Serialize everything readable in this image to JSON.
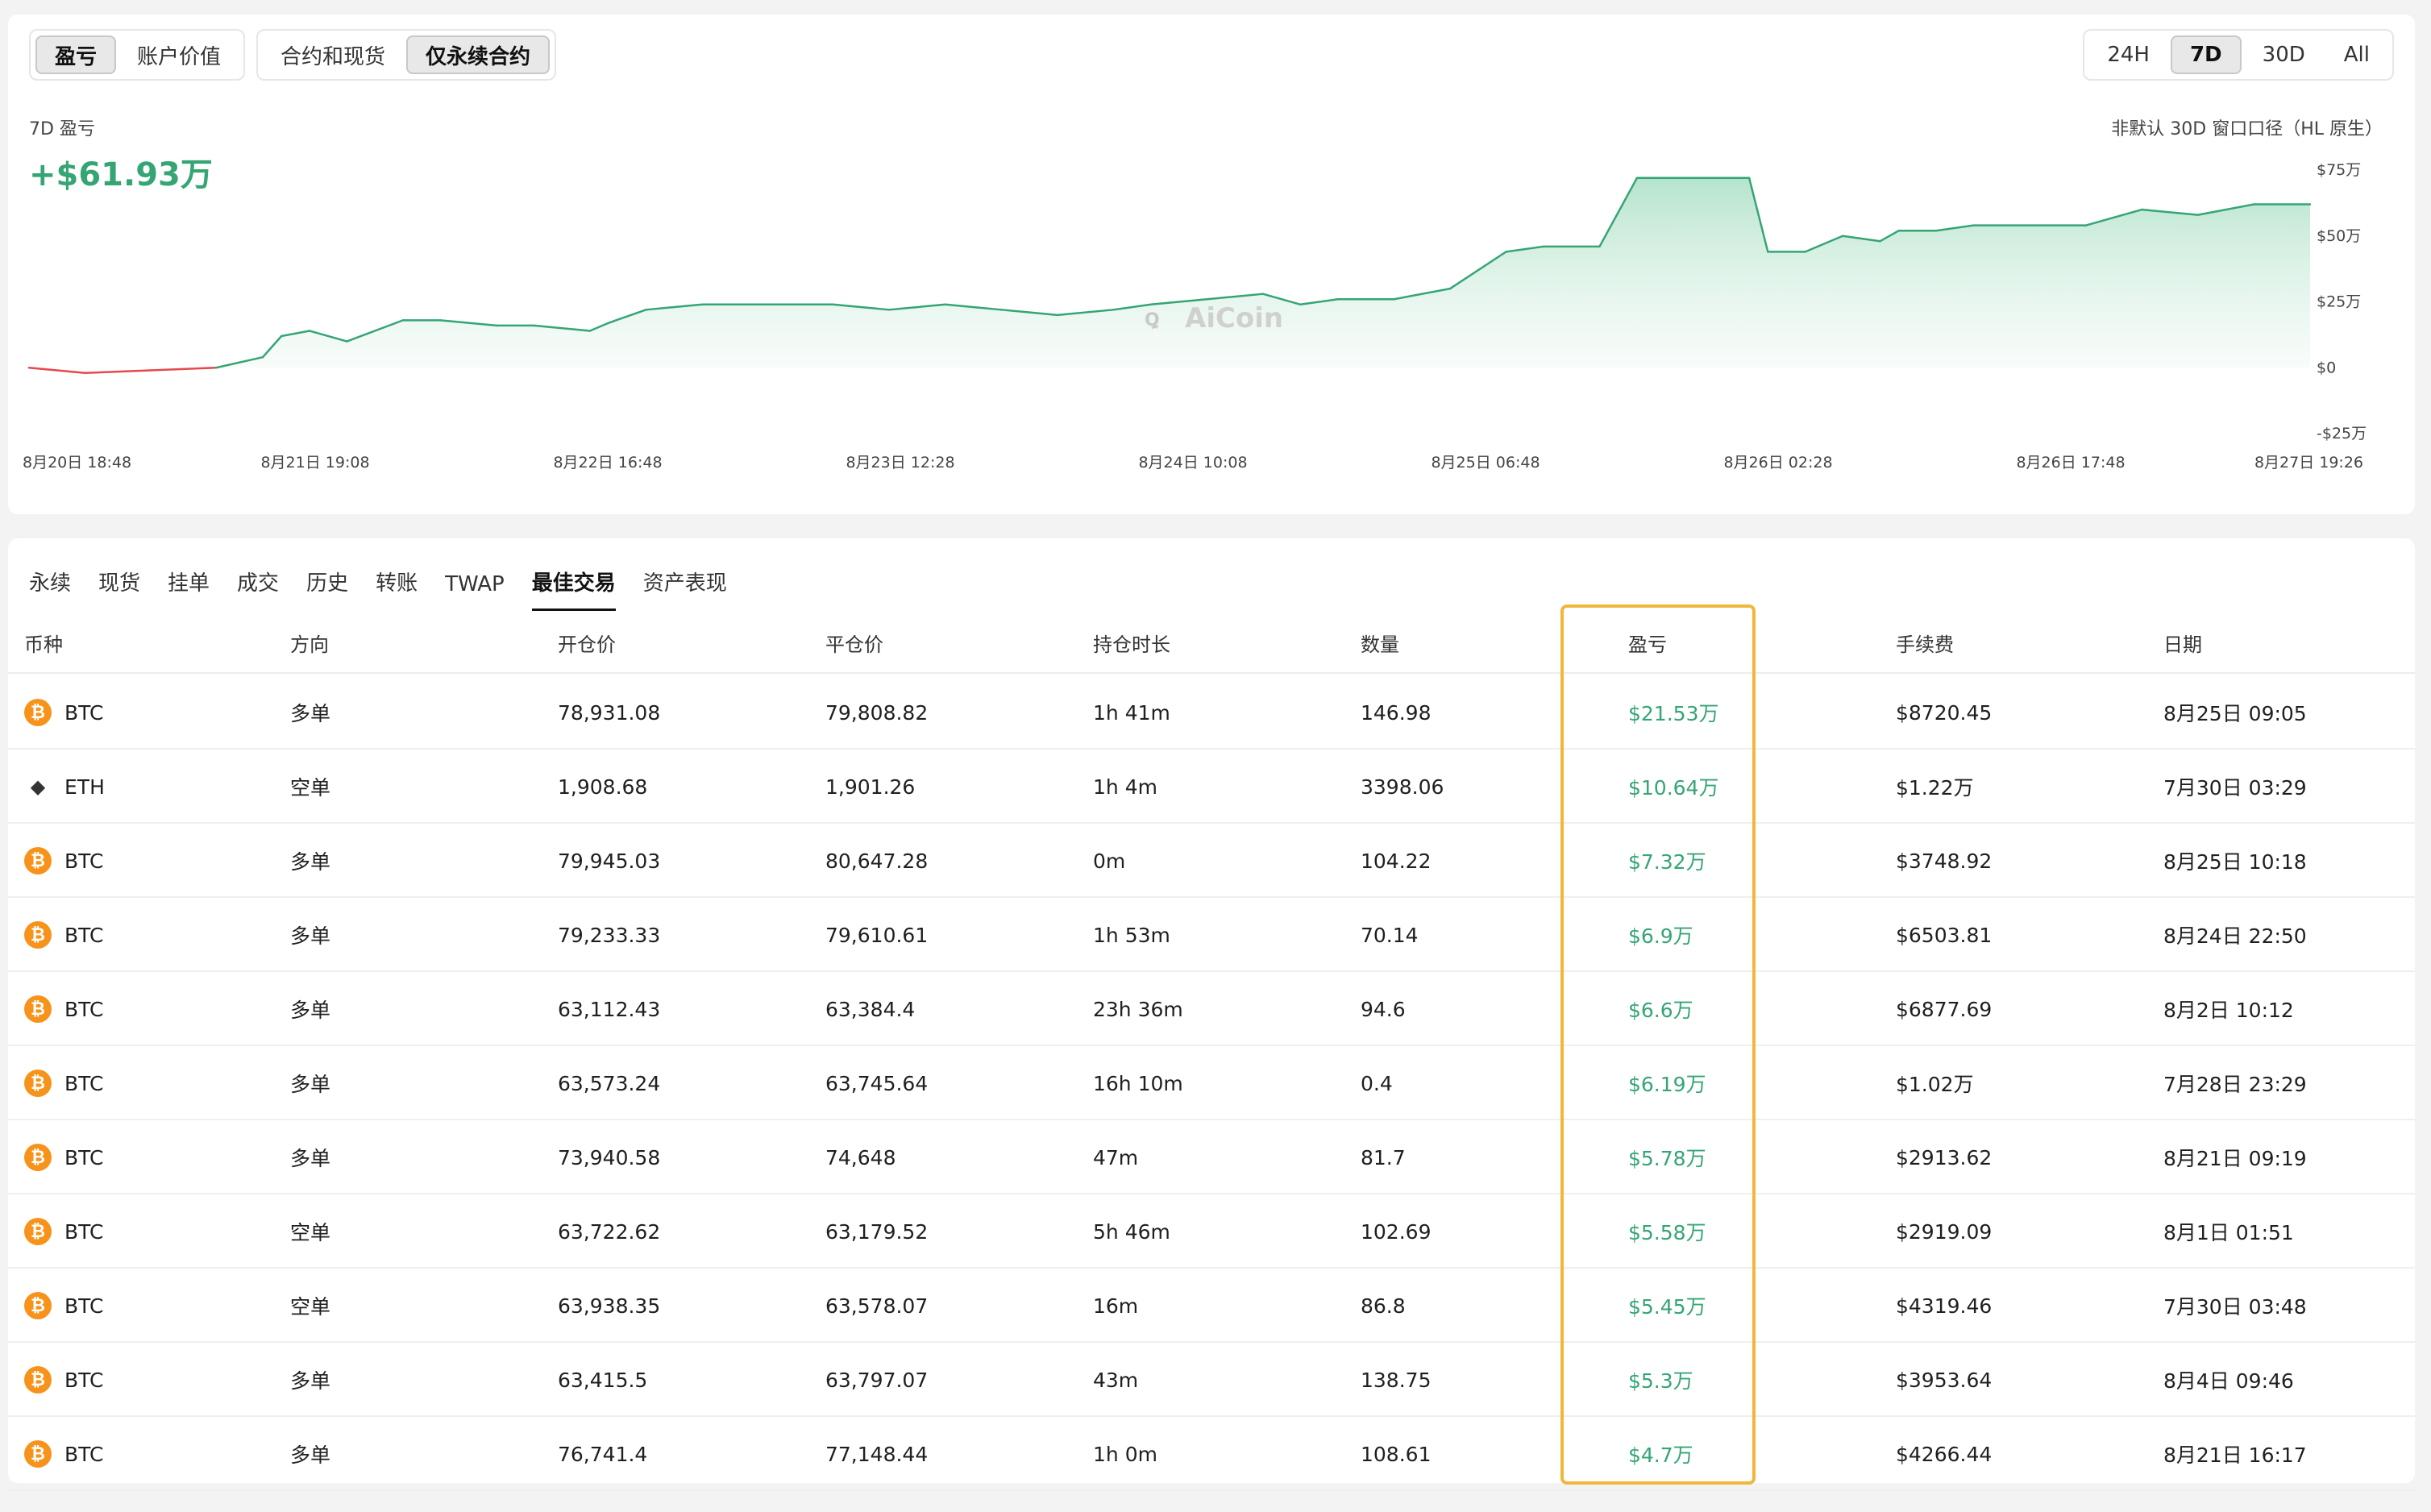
{
  "controls": {
    "metric_tabs": [
      {
        "label": "盈亏",
        "active": true
      },
      {
        "label": "账户价值",
        "active": false
      }
    ],
    "scope_tabs": [
      {
        "label": "合约和现货",
        "active": false
      },
      {
        "label": "仅永续合约",
        "active": true
      }
    ],
    "range_tabs": [
      {
        "label": "24H",
        "active": false
      },
      {
        "label": "7D",
        "active": true
      },
      {
        "label": "30D",
        "active": false
      },
      {
        "label": "All",
        "active": false
      }
    ]
  },
  "chart": {
    "label": "7D 盈亏",
    "value": "+$61.93万",
    "note": "非默认 30D 窗口口径（HL 原生）",
    "watermark": "AiCoin",
    "colors": {
      "positive": "#35a574",
      "negative": "#e5484d",
      "fill": "#cdeedd"
    }
  },
  "chart_data": {
    "type": "area",
    "y_unit": "万",
    "ylim": [
      -25,
      75
    ],
    "yticks": [
      {
        "value": 75,
        "label": "$75万"
      },
      {
        "value": 50,
        "label": "$50万"
      },
      {
        "value": 25,
        "label": "$25万"
      },
      {
        "value": 0,
        "label": "$0"
      },
      {
        "value": -25,
        "label": "-$25万"
      }
    ],
    "xticks": [
      "8月20日 18:48",
      "8月21日 19:08",
      "8月22日 16:48",
      "8月23日 12:28",
      "8月24日 10:08",
      "8月25日 06:48",
      "8月26日 02:28",
      "8月26日 17:48",
      "8月27日 19:26"
    ],
    "x": [
      0,
      0.03,
      0.065,
      0.1,
      0.125,
      0.135,
      0.15,
      0.17,
      0.2,
      0.22,
      0.25,
      0.27,
      0.3,
      0.31,
      0.33,
      0.36,
      0.4,
      0.43,
      0.46,
      0.49,
      0.52,
      0.55,
      0.58,
      0.6,
      0.63,
      0.66,
      0.68,
      0.7,
      0.73,
      0.76,
      0.79,
      0.81,
      0.84,
      0.86,
      0.88,
      0.9,
      0.92,
      0.93,
      0.95,
      0.97,
      0.99,
      1.0,
      1.02,
      1.04,
      1.07,
      1.1,
      1.13,
      1.16,
      1.19,
      1.22
    ],
    "y": [
      0,
      -2,
      -1,
      0,
      4,
      12,
      14,
      10,
      18,
      18,
      16,
      16,
      14,
      17,
      22,
      24,
      24,
      24,
      22,
      24,
      22,
      20,
      22,
      24,
      26,
      28,
      24,
      26,
      26,
      30,
      44,
      46,
      46,
      72,
      72,
      72,
      72,
      44,
      44,
      50,
      48,
      52,
      52,
      54,
      54,
      54,
      60,
      58,
      62,
      62
    ]
  },
  "table": {
    "tabs": [
      {
        "label": "永续",
        "active": false
      },
      {
        "label": "现货",
        "active": false
      },
      {
        "label": "挂单",
        "active": false
      },
      {
        "label": "成交",
        "active": false
      },
      {
        "label": "历史",
        "active": false
      },
      {
        "label": "转账",
        "active": false
      },
      {
        "label": "TWAP",
        "active": false
      },
      {
        "label": "最佳交易",
        "active": true
      },
      {
        "label": "资产表现",
        "active": false
      }
    ],
    "columns": [
      "币种",
      "方向",
      "开仓价",
      "平仓价",
      "持仓时长",
      "数量",
      "盈亏",
      "手续费",
      "日期"
    ],
    "rows": [
      {
        "coin": "BTC",
        "icon": "bitcoin-icon",
        "side": "多单",
        "open": "78,931.08",
        "close": "79,808.82",
        "duration": "1h 41m",
        "qty": "146.98",
        "pnl": "$21.53万",
        "fee": "$8720.45",
        "date": "8月25日 09:05"
      },
      {
        "coin": "ETH",
        "icon": "ethereum-icon",
        "side": "空单",
        "open": "1,908.68",
        "close": "1,901.26",
        "duration": "1h 4m",
        "qty": "3398.06",
        "pnl": "$10.64万",
        "fee": "$1.22万",
        "date": "7月30日 03:29"
      },
      {
        "coin": "BTC",
        "icon": "bitcoin-icon",
        "side": "多单",
        "open": "79,945.03",
        "close": "80,647.28",
        "duration": "0m",
        "qty": "104.22",
        "pnl": "$7.32万",
        "fee": "$3748.92",
        "date": "8月25日 10:18"
      },
      {
        "coin": "BTC",
        "icon": "bitcoin-icon",
        "side": "多单",
        "open": "79,233.33",
        "close": "79,610.61",
        "duration": "1h 53m",
        "qty": "70.14",
        "pnl": "$6.9万",
        "fee": "$6503.81",
        "date": "8月24日 22:50"
      },
      {
        "coin": "BTC",
        "icon": "bitcoin-icon",
        "side": "多单",
        "open": "63,112.43",
        "close": "63,384.4",
        "duration": "23h 36m",
        "qty": "94.6",
        "pnl": "$6.6万",
        "fee": "$6877.69",
        "date": "8月2日 10:12"
      },
      {
        "coin": "BTC",
        "icon": "bitcoin-icon",
        "side": "多单",
        "open": "63,573.24",
        "close": "63,745.64",
        "duration": "16h 10m",
        "qty": "0.4",
        "pnl": "$6.19万",
        "fee": "$1.02万",
        "date": "7月28日 23:29"
      },
      {
        "coin": "BTC",
        "icon": "bitcoin-icon",
        "side": "多单",
        "open": "73,940.58",
        "close": "74,648",
        "duration": "47m",
        "qty": "81.7",
        "pnl": "$5.78万",
        "fee": "$2913.62",
        "date": "8月21日 09:19"
      },
      {
        "coin": "BTC",
        "icon": "bitcoin-icon",
        "side": "空单",
        "open": "63,722.62",
        "close": "63,179.52",
        "duration": "5h 46m",
        "qty": "102.69",
        "pnl": "$5.58万",
        "fee": "$2919.09",
        "date": "8月1日 01:51"
      },
      {
        "coin": "BTC",
        "icon": "bitcoin-icon",
        "side": "空单",
        "open": "63,938.35",
        "close": "63,578.07",
        "duration": "16m",
        "qty": "86.8",
        "pnl": "$5.45万",
        "fee": "$4319.46",
        "date": "7月30日 03:48"
      },
      {
        "coin": "BTC",
        "icon": "bitcoin-icon",
        "side": "多单",
        "open": "63,415.5",
        "close": "63,797.07",
        "duration": "43m",
        "qty": "138.75",
        "pnl": "$5.3万",
        "fee": "$3953.64",
        "date": "8月4日 09:46"
      },
      {
        "coin": "BTC",
        "icon": "bitcoin-icon",
        "side": "多单",
        "open": "76,741.4",
        "close": "77,148.44",
        "duration": "1h 0m",
        "qty": "108.61",
        "pnl": "$4.7万",
        "fee": "$4266.44",
        "date": "8月21日 16:17"
      }
    ],
    "highlight_color": "#f0b73c"
  }
}
